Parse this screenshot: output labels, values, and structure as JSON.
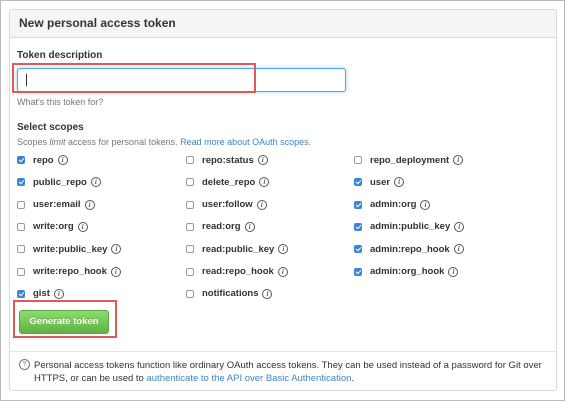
{
  "panel": {
    "title": "New personal access token"
  },
  "form": {
    "token_label": "Token description",
    "token_value": "",
    "token_help": "What's this token for?",
    "scopes_label": "Select scopes",
    "scopes_desc_pre": "Scopes ",
    "scopes_desc_em": "limit",
    "scopes_desc_post": " access for personal tokens. ",
    "scopes_link": "Read more about OAuth scopes.",
    "submit_label": "Generate token"
  },
  "scopes": [
    {
      "label": "repo",
      "checked": true
    },
    {
      "label": "repo:status",
      "checked": false
    },
    {
      "label": "repo_deployment",
      "checked": false
    },
    {
      "label": "public_repo",
      "checked": true
    },
    {
      "label": "delete_repo",
      "checked": false
    },
    {
      "label": "user",
      "checked": true
    },
    {
      "label": "user:email",
      "checked": false
    },
    {
      "label": "user:follow",
      "checked": false
    },
    {
      "label": "admin:org",
      "checked": true
    },
    {
      "label": "write:org",
      "checked": false
    },
    {
      "label": "read:org",
      "checked": false
    },
    {
      "label": "admin:public_key",
      "checked": true
    },
    {
      "label": "write:public_key",
      "checked": false
    },
    {
      "label": "read:public_key",
      "checked": false
    },
    {
      "label": "admin:repo_hook",
      "checked": true
    },
    {
      "label": "write:repo_hook",
      "checked": false
    },
    {
      "label": "read:repo_hook",
      "checked": false
    },
    {
      "label": "admin:org_hook",
      "checked": true
    },
    {
      "label": "gist",
      "checked": true
    },
    {
      "label": "notifications",
      "checked": false
    }
  ],
  "footer": {
    "text": "Personal access tokens function like ordinary OAuth access tokens. They can be used instead of a password for Git over HTTPS, or can be used to ",
    "link": "authenticate to the API over Basic Authentication",
    "end": "."
  },
  "colors": {
    "accent": "#4183c4",
    "checkbox": "#3f83d9",
    "button": "#60b044",
    "highlight": "#e05a55"
  }
}
